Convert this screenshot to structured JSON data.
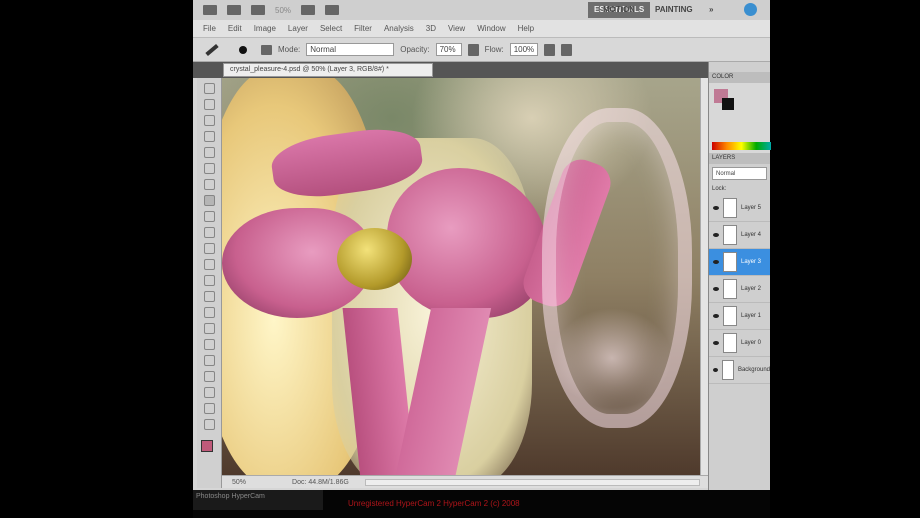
{
  "topbar": {
    "zoom": "50%",
    "workspaces": [
      "ESSENTIALS",
      "MOTION",
      "PAINTING"
    ],
    "more": "»"
  },
  "menu": [
    "File",
    "Edit",
    "Image",
    "Layer",
    "Select",
    "Filter",
    "Analysis",
    "3D",
    "View",
    "Window",
    "Help"
  ],
  "options": {
    "mode_label": "Mode:",
    "mode_value": "Normal",
    "opacity_label": "Opacity:",
    "opacity_value": "70%",
    "flow_label": "Flow:",
    "flow_value": "100%"
  },
  "document": {
    "tab_title": "crystal_pleasure-4.psd @ 50% (Layer 3, RGB/8#) *",
    "zoom": "50%",
    "doc_info": "Doc: 44.8M/1.86G"
  },
  "panels": {
    "color_tab": "COLOR",
    "layers_tab": "LAYERS",
    "blend_mode": "Normal",
    "lock_label": "Lock:",
    "layers": [
      {
        "name": "Layer 5",
        "selected": false
      },
      {
        "name": "Layer 4",
        "selected": false
      },
      {
        "name": "Layer 3",
        "selected": true
      },
      {
        "name": "Layer 2",
        "selected": false
      },
      {
        "name": "Layer 1",
        "selected": false
      },
      {
        "name": "Layer 0",
        "selected": false
      },
      {
        "name": "Background",
        "selected": false
      }
    ]
  },
  "recording": {
    "text": "Unregistered HyperCam 2  HyperCam 2 (c) 2008"
  },
  "taskbar": {
    "items": [
      "Photoshop",
      "HyperCam"
    ]
  }
}
